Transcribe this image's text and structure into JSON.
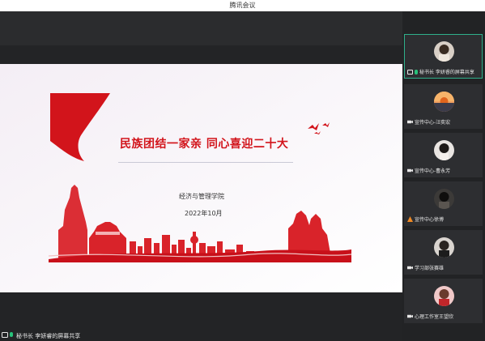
{
  "window": {
    "title": "腾讯会议"
  },
  "slide": {
    "title": "民族团结一家亲 同心喜迎二十大",
    "college": "经济与管理学院",
    "date": "2022年10月"
  },
  "bottom_bar": {
    "label": "秘书长 李妍睿的屏幕共享"
  },
  "participants": [
    {
      "name": "秘书长 李妍睿的屏幕共享",
      "icon": "screen-share-icon",
      "active": true
    },
    {
      "name": "宣传中心-汪奕宏",
      "icon": "camera-off-icon",
      "active": false
    },
    {
      "name": "宣传中心-曹永芳",
      "icon": "camera-off-icon",
      "active": false
    },
    {
      "name": "宣传中心徐博",
      "icon": "warning-icon",
      "active": false
    },
    {
      "name": "学习部张赛雄",
      "icon": "camera-off-icon",
      "active": false
    },
    {
      "name": "心理工作室王望欣",
      "icon": "camera-off-icon",
      "active": false
    }
  ],
  "colors": {
    "accent_red": "#d2141b",
    "active_border": "#2fb08b",
    "mic_green": "#27c27a"
  }
}
